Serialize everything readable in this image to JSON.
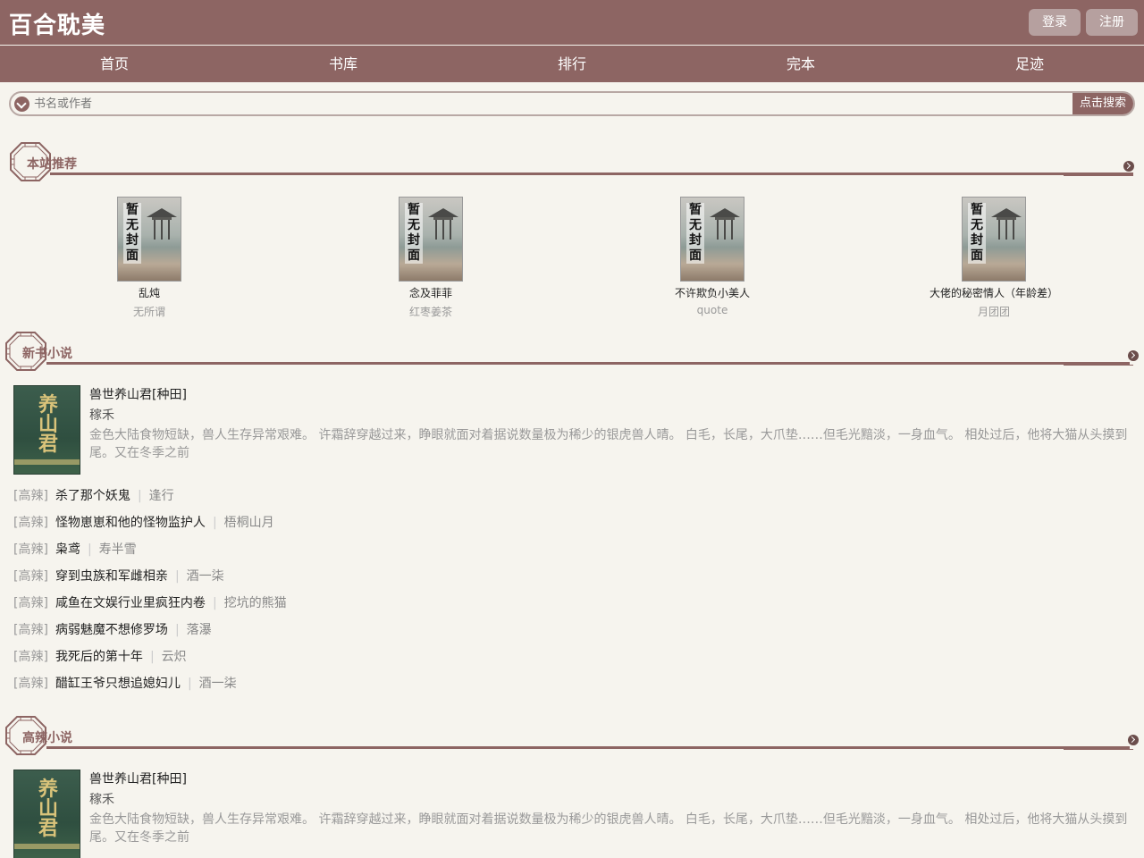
{
  "header": {
    "title": "百合耽美",
    "login": "登录",
    "register": "注册"
  },
  "nav": [
    "首页",
    "书库",
    "排行",
    "完本",
    "足迹"
  ],
  "search": {
    "placeholder": "书名或作者",
    "button": "点击搜索"
  },
  "sections": {
    "recommend": "本站推荐",
    "newbooks": "新书小说",
    "hot": "高辣小说"
  },
  "cover_placeholder": "暂无封面",
  "recommend_items": [
    {
      "title": "乱炖",
      "author": "无所谓"
    },
    {
      "title": "念及菲菲",
      "author": "红枣姜茶"
    },
    {
      "title": "不许欺负小美人",
      "author": "quote"
    },
    {
      "title": "大佬的秘密情人（年龄差）",
      "author": "月团团"
    }
  ],
  "featured": {
    "title": "兽世养山君[种田]",
    "author": "稼禾",
    "cover_text": "养山君",
    "description": "金色大陆食物短缺，兽人生存异常艰难。 许霜辞穿越过来，睁眼就面对着据说数量极为稀少的银虎兽人晴。 白毛，长尾，大爪垫……但毛光黯淡，一身血气。 相处过后，他将大猫从头摸到尾。又在冬季之前"
  },
  "newbook_list": [
    {
      "tag": "[高辣]",
      "title": "杀了那个妖鬼",
      "author": "逢行"
    },
    {
      "tag": "[高辣]",
      "title": "怪物崽崽和他的怪物监护人",
      "author": "梧桐山月"
    },
    {
      "tag": "[高辣]",
      "title": "枭鸢",
      "author": "寿半雪"
    },
    {
      "tag": "[高辣]",
      "title": "穿到虫族和军雌相亲",
      "author": "酒一柒"
    },
    {
      "tag": "[高辣]",
      "title": "咸鱼在文娱行业里疯狂内卷",
      "author": "挖坑的熊猫"
    },
    {
      "tag": "[高辣]",
      "title": "病弱魅魔不想修罗场",
      "author": "落瀑"
    },
    {
      "tag": "[高辣]",
      "title": "我死后的第十年",
      "author": "云炽"
    },
    {
      "tag": "[高辣]",
      "title": "醋缸王爷只想追媳妇儿",
      "author": "酒一柒"
    }
  ],
  "colors": {
    "brand": "#8d6563",
    "background": "#f6f4ee",
    "muted_text": "#999999"
  }
}
